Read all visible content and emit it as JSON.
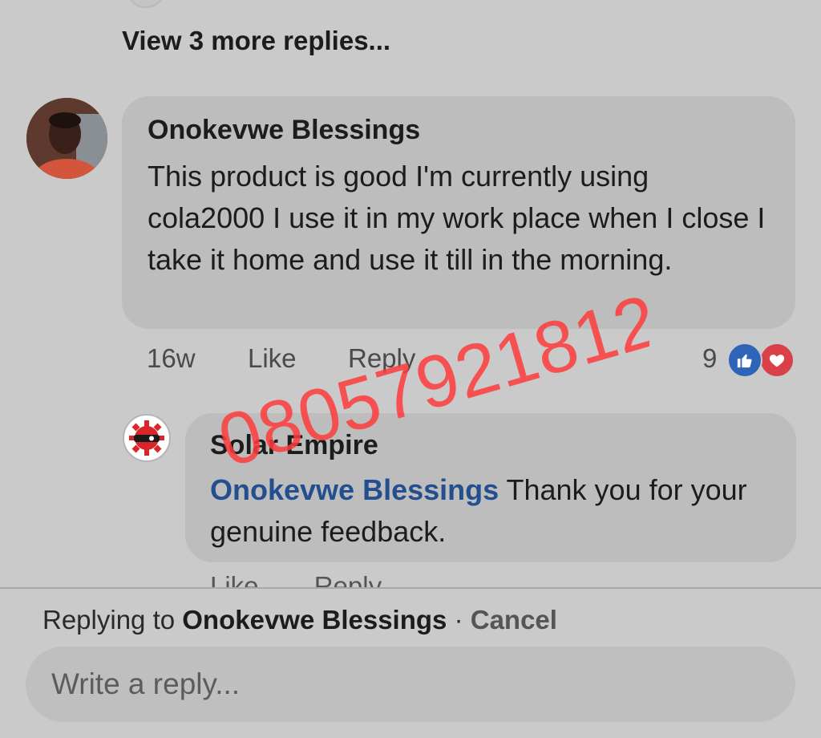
{
  "thread": {
    "view_more_label": "View 3 more replies..."
  },
  "comment": {
    "author": "Onokevwe Blessings",
    "text": "This product is good I'm currently using cola2000 I use it in my work place when I close I take it home and use it till in the morning.",
    "time": "16w",
    "like_label": "Like",
    "reply_label": "Reply",
    "reaction_count": "9",
    "reactions": [
      "like-icon",
      "love-icon"
    ]
  },
  "reply": {
    "author": "Solar Empire",
    "mention": "Onokevwe Blessings",
    "text": " Thank you for your genuine feedback."
  },
  "composer": {
    "replying_prefix": "Replying to ",
    "replying_name": "Onokevwe Blessings",
    "separator": " · ",
    "cancel_label": "Cancel",
    "placeholder": "Write a reply..."
  },
  "watermark": {
    "text": "08057921812",
    "color": "#ff3b3b"
  },
  "colors": {
    "background": "#cacaca",
    "bubble": "#bdbdbd",
    "mention": "#234f8f",
    "like": "#2e65b8",
    "love": "#d9404a"
  }
}
